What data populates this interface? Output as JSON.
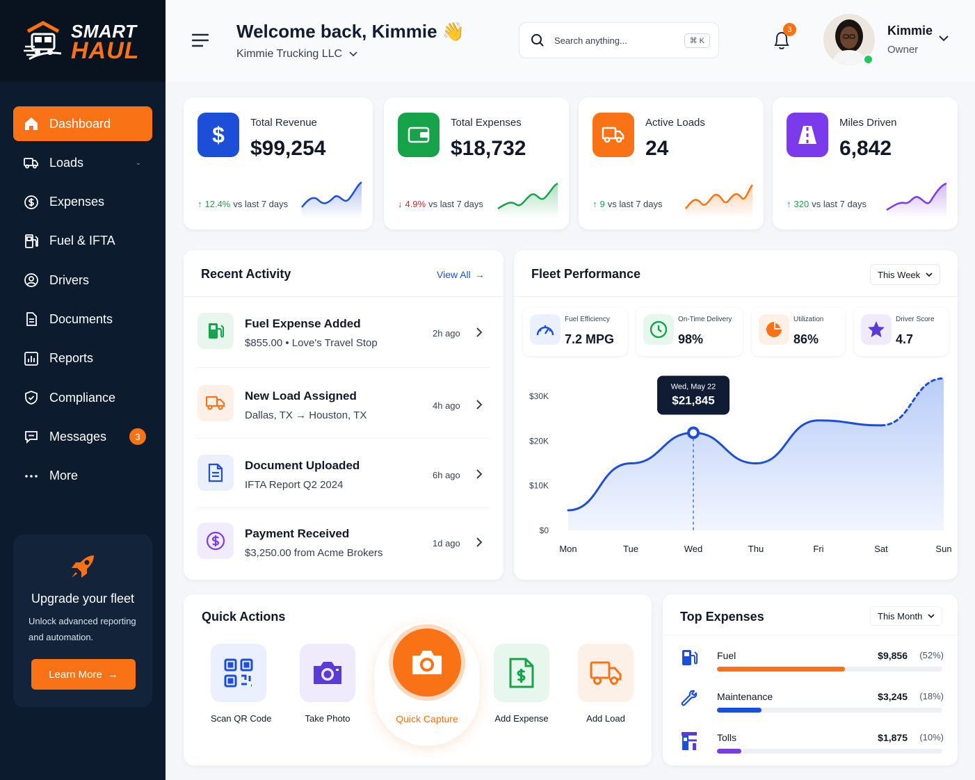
{
  "brand": {
    "line1": "SMART",
    "line2": "HAUL"
  },
  "sidebar": {
    "items": [
      {
        "label": "Dashboard",
        "icon": "home-icon",
        "active": true
      },
      {
        "label": "Loads",
        "icon": "truck-icon"
      },
      {
        "label": "Expenses",
        "icon": "dollar-circle-icon"
      },
      {
        "label": "Fuel & IFTA",
        "icon": "fuel-pump-icon"
      },
      {
        "label": "Drivers",
        "icon": "user-circle-icon"
      },
      {
        "label": "Documents",
        "icon": "document-icon"
      },
      {
        "label": "Reports",
        "icon": "bar-chart-icon"
      },
      {
        "label": "Compliance",
        "icon": "shield-check-icon"
      },
      {
        "label": "Messages",
        "icon": "chat-icon",
        "badge": "3"
      },
      {
        "label": "More",
        "icon": "more-dots-icon"
      }
    ],
    "upgrade": {
      "title": "Upgrade your fleet",
      "text": "Unlock advanced reporting and automation.",
      "button": "Learn More"
    }
  },
  "header": {
    "welcome": "Welcome back, Kimmie 👋",
    "company": "Kimmie Trucking LLC",
    "search_placeholder": "Search anything...",
    "search_shortcut": "⌘ K",
    "notifications": "3",
    "user": {
      "name": "Kimmie",
      "role": "Owner"
    }
  },
  "stats": [
    {
      "label": "Total Revenue",
      "value": "$99,254",
      "change": "12.4%",
      "change_suffix": "vs last 7 days",
      "direction": "up",
      "color": "#1d4ed8",
      "icon": "dollar-icon"
    },
    {
      "label": "Total Expenses",
      "value": "$18,732",
      "change": "4.9%",
      "change_suffix": "vs last 7 days",
      "direction": "down",
      "color": "#16a34a",
      "icon": "wallet-icon"
    },
    {
      "label": "Active Loads",
      "value": "24",
      "change": "9",
      "change_suffix": "vs last 7 days",
      "direction": "up",
      "color": "#f97316",
      "icon": "truck-icon"
    },
    {
      "label": "Miles Driven",
      "value": "6,842",
      "change": "320",
      "change_suffix": "vs last 7 days",
      "direction": "up",
      "color": "#7c3aed",
      "icon": "road-icon"
    }
  ],
  "recent_activity": {
    "title": "Recent Activity",
    "view_all": "View All",
    "items": [
      {
        "title": "Fuel Expense Added",
        "subtitle": "$855.00 • Love's Travel Stop",
        "time": "2h ago",
        "icon": "fuel-pump-icon",
        "color": "#16a34a"
      },
      {
        "title": "New Load Assigned",
        "subtitle": "Dallas, TX → Houston, TX",
        "time": "4h ago",
        "icon": "truck-icon",
        "color": "#f97316"
      },
      {
        "title": "Document Uploaded",
        "subtitle": "IFTA Report Q2 2024",
        "time": "6h ago",
        "icon": "document-icon",
        "color": "#1d4ed8"
      },
      {
        "title": "Payment Received",
        "subtitle": "$3,250.00 from Acme Brokers",
        "time": "1d ago",
        "icon": "dollar-circle-icon",
        "color": "#7c3aed"
      }
    ]
  },
  "fleet": {
    "title": "Fleet Performance",
    "period": "This Week",
    "kpis": [
      {
        "label": "Fuel Efficiency",
        "value": "7.2 MPG",
        "icon": "gauge-icon",
        "color": "#1d4ed8"
      },
      {
        "label": "On-Time Delivery",
        "value": "98%",
        "icon": "clock-icon",
        "color": "#16a34a"
      },
      {
        "label": "Utilization",
        "value": "86%",
        "icon": "pie-icon",
        "color": "#f97316"
      },
      {
        "label": "Driver Score",
        "value": "4.7",
        "icon": "star-icon",
        "color": "#5b3bd6"
      }
    ],
    "tooltip": {
      "date": "Wed, May 22",
      "value": "$21,845"
    }
  },
  "chart_data": {
    "type": "area",
    "categories": [
      "Mon",
      "Tue",
      "Wed",
      "Thu",
      "Fri",
      "Sat",
      "Sun"
    ],
    "y_ticks": [
      "$0",
      "$10K",
      "$20K",
      "$30K"
    ],
    "ylim": [
      0,
      30000
    ],
    "series": [
      {
        "values": [
          4500,
          15000,
          21845,
          15000,
          24600,
          23500,
          34000
        ]
      }
    ],
    "dashed_segment": [
      "Sat",
      "Sun"
    ],
    "highlight": "Wed"
  },
  "quick_actions": {
    "title": "Quick Actions",
    "items": [
      {
        "label": "Scan QR Code",
        "icon": "qr-code-icon",
        "color": "#1d4ed8"
      },
      {
        "label": "Take Photo",
        "icon": "camera-icon",
        "color": "#5b3bd6"
      },
      {
        "label": "Quick Capture",
        "icon": "camera-icon",
        "color": "#f97316"
      },
      {
        "label": "Add Expense",
        "icon": "receipt-dollar-icon",
        "color": "#16a34a"
      },
      {
        "label": "Add Load",
        "icon": "truck-icon",
        "color": "#f97316"
      }
    ]
  },
  "top_expenses": {
    "title": "Top Expenses",
    "period": "This Month",
    "items": [
      {
        "name": "Fuel",
        "amount": "$9,856",
        "percent": "(52%)",
        "share": 0.52,
        "color": "#f97316",
        "icon": "fuel-pump-icon"
      },
      {
        "name": "Maintenance",
        "amount": "$3,245",
        "percent": "(18%)",
        "share": 0.18,
        "color": "#1d4ed8",
        "icon": "wrench-icon"
      },
      {
        "name": "Tolls",
        "amount": "$1,875",
        "percent": "(10%)",
        "share": 0.1,
        "color": "#7c3aed",
        "icon": "toll-booth-icon"
      }
    ]
  }
}
